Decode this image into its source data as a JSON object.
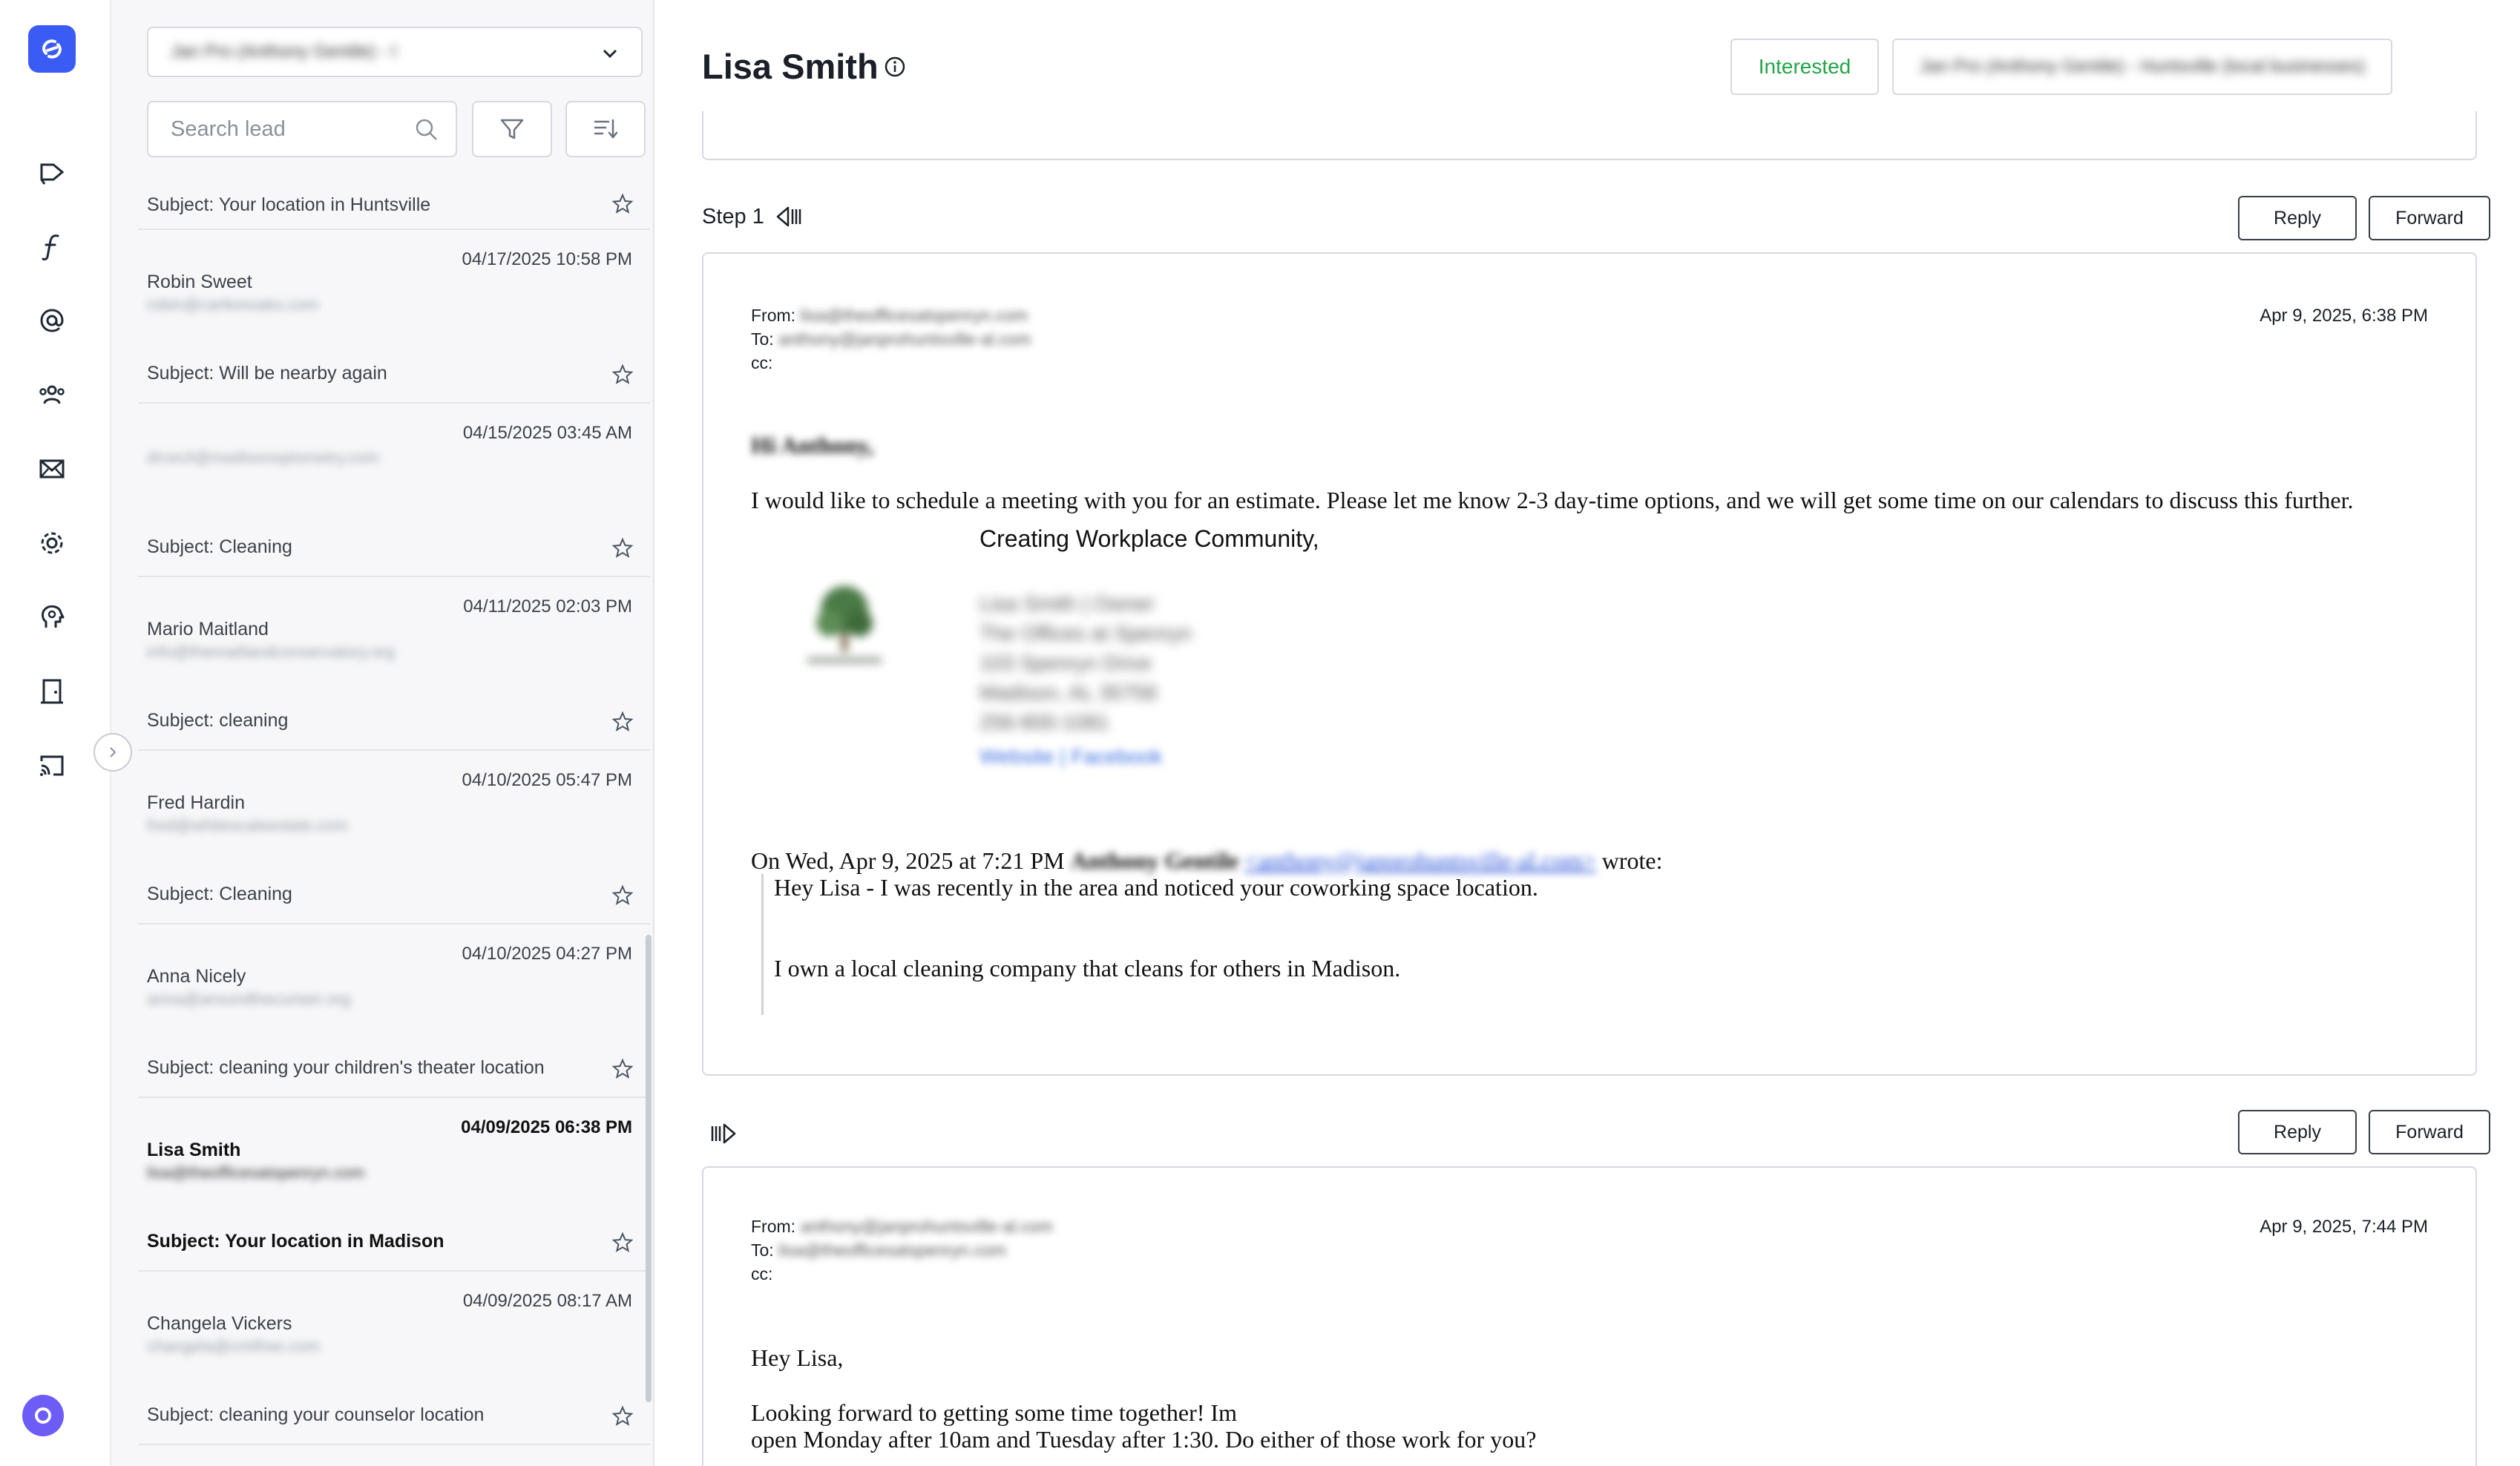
{
  "rail": {
    "icons": [
      "campaigns-icon",
      "function-icon",
      "at-sign-icon",
      "contacts-icon",
      "inbox-icon",
      "settings-icon",
      "ai-brain-icon",
      "door-icon",
      "cast-icon"
    ]
  },
  "panel": {
    "campaign_select_value": "Jan Pro (Anthony Gentile) - I",
    "search_placeholder": "Search lead",
    "leads": [
      {
        "subject": "Subject: Your location in Huntsville",
        "date": "",
        "name": "",
        "email": ""
      },
      {
        "date": "04/17/2025 10:58 PM",
        "name": "Robin Sweet",
        "email": "robin@carltonoaks.com",
        "subject": "Subject: Will be nearby again"
      },
      {
        "date": "04/15/2025 03:45 AM",
        "name": "",
        "email": "drcecil@madisonoptometry.com",
        "subject": "Subject: Cleaning"
      },
      {
        "date": "04/11/2025 02:03 PM",
        "name": "Mario Maitland",
        "email": "info@themaitlandconservatory.org",
        "subject": "Subject: cleaning"
      },
      {
        "date": "04/10/2025 05:47 PM",
        "name": "Fred Hardin",
        "email": "fred@whitescaleestate.com",
        "subject": "Subject: Cleaning"
      },
      {
        "date": "04/10/2025 04:27 PM",
        "name": "Anna Nicely",
        "email": "anna@aroundthecurtain.org",
        "subject": "Subject: cleaning your children's theater location"
      },
      {
        "date": "04/09/2025 06:38 PM",
        "name": "Lisa Smith",
        "email": "lisa@theofficesatspenryn.com",
        "subject": "Subject: Your location in Madison",
        "active": true
      },
      {
        "date": "04/09/2025 08:17 AM",
        "name": "Changela Vickers",
        "email": "changela@cmtfree.com",
        "subject": "Subject: cleaning your counselor location"
      }
    ]
  },
  "main": {
    "lead_name": "Lisa Smith",
    "status_label": "Interested",
    "campaign_label": "Jan Pro (Anthony Gentile) - Huntsville (local businesses)",
    "step_label": "Step 1",
    "reply_label": "Reply",
    "forward_label": "Forward",
    "message1": {
      "from_label": "From:",
      "from": "lisa@theofficesatspenryn.com",
      "to_label": "To:",
      "to": "anthony@janprohuntsville-al.com",
      "cc_label": "cc:",
      "date": "Apr 9, 2025, 6:38 PM",
      "greeting": "Hi Anthony,",
      "body": "I would like to schedule a meeting with you for an estimate. Please let me know 2-3 day-time options, and we will get some time on our calendars to discuss this further.",
      "sig_heading": "Creating Workplace Community,",
      "sig_lines": [
        "Lisa Smith | Owner",
        "The Offices at Spenryn",
        "103 Spenryn Drive",
        "Madison, AL 35758",
        "256-800-1081"
      ],
      "sig_links": "Website | Facebook",
      "quote_intro_prefix": "On Wed, Apr 9, 2025 at 7:21 PM",
      "quote_author": "Anthony Gentile",
      "quote_email": "<anthony@janprohuntsville-al.com>",
      "quote_intro_suffix": "wrote:",
      "quote_line1": "Hey Lisa - I was recently in the area and noticed your coworking space location.",
      "quote_line2": "I own a local cleaning company that cleans for others in Madison."
    },
    "message2": {
      "from_label": "From:",
      "from": "anthony@janprohuntsville-al.com",
      "to_label": "To:",
      "to": "lisa@theofficesatspenryn.com",
      "cc_label": "cc:",
      "date": "Apr 9, 2025, 7:44 PM",
      "greeting": "Hey Lisa,",
      "line1": "Looking forward to getting some time together! Im",
      "line2": "open Monday after 10am and Tuesday after 1:30. Do either of those work for you?"
    }
  },
  "colors": {
    "accent": "#3b5bf5",
    "interested": "#22a447",
    "avatar": "#6d5cf6"
  }
}
